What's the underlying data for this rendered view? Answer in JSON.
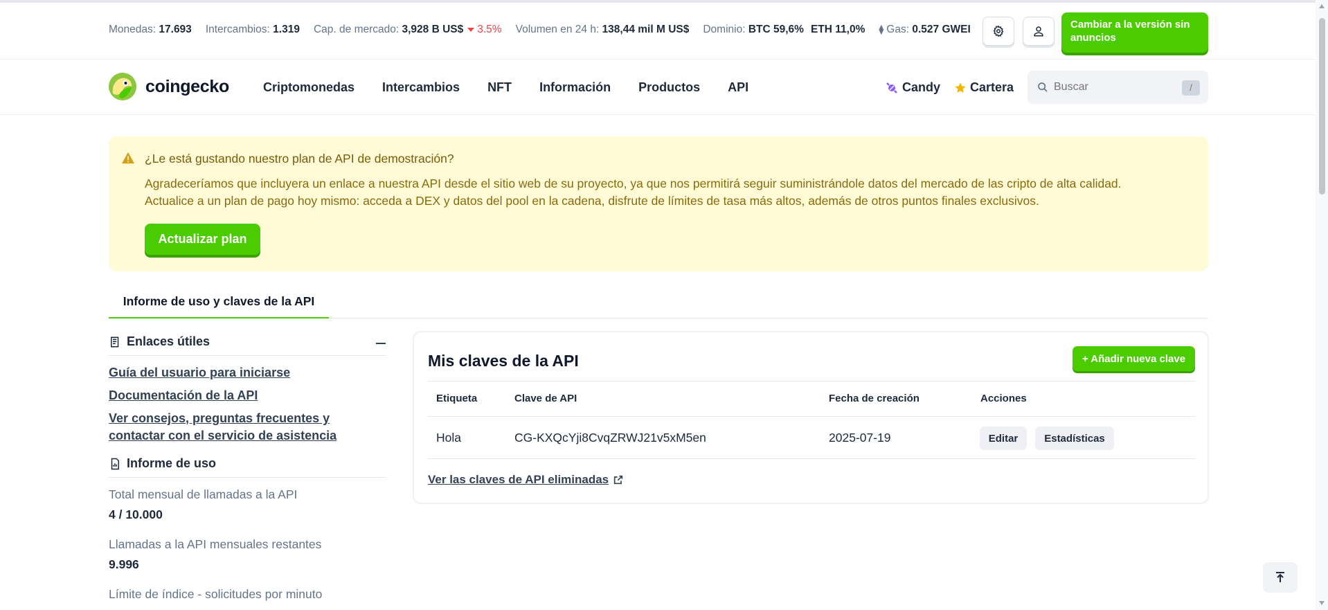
{
  "stats": {
    "coins_label": "Monedas:",
    "coins_value": "17.693",
    "exchanges_label": "Intercambios:",
    "exchanges_value": "1.319",
    "marketcap_label": "Cap. de mercado:",
    "marketcap_value": "3,928 B US$",
    "marketcap_change": "3.5%",
    "volume_label": "Volumen en 24 h:",
    "volume_value": "138,44 mil M US$",
    "dominance_label": "Dominio:",
    "btc_dominance": "BTC 59,6%",
    "eth_dominance": "ETH 11,0%",
    "gas_label": "Gas:",
    "gas_value": "0.527 GWEI"
  },
  "header": {
    "adfree_button": "Cambiar a la versión sin anuncios",
    "accent_color": "#4bcc00"
  },
  "nav": {
    "logo_text": "coingecko",
    "links": [
      "Criptomonedas",
      "Intercambios",
      "NFT",
      "Información",
      "Productos",
      "API"
    ],
    "candy": "Candy",
    "portfolio": "Cartera",
    "search_placeholder": "Buscar",
    "search_shortcut": "/"
  },
  "banner": {
    "title": "¿Le está gustando nuestro plan de API de demostración?",
    "body_line1": "Agradeceríamos que incluyera un enlace a nuestra API desde el sitio web de su proyecto, ya que nos permitirá seguir suministrándole datos del mercado de las cripto de alta calidad.",
    "body_line2": "Actualice a un plan de pago hoy mismo: acceda a DEX y datos del pool en la cadena, disfrute de límites de tasa más altos, además de otros puntos finales exclusivos.",
    "button": "Actualizar plan"
  },
  "tabs": {
    "active": "Informe de uso y claves de la API"
  },
  "sidebar": {
    "useful_links_title": "Enlaces útiles",
    "links": [
      "Guía del usuario para iniciarse",
      "Documentación de la API",
      "Ver consejos, preguntas frecuentes y contactar con el servicio de asistencia"
    ],
    "usage_title": "Informe de uso",
    "usage": [
      {
        "label": "Total mensual de llamadas a la API",
        "value": "4 / 10.000"
      },
      {
        "label": "Llamadas a la API mensuales restantes",
        "value": "9.996"
      },
      {
        "label": "Límite de índice - solicitudes por minuto",
        "value": ""
      }
    ]
  },
  "keys_card": {
    "title": "Mis claves de la API",
    "add_button": "+ Añadir nueva clave",
    "columns": [
      "Etiqueta",
      "Clave de API",
      "Fecha de creación",
      "Acciones"
    ],
    "rows": [
      {
        "label": "Hola",
        "key": "CG-KXQcYji8CvqZRWJ21v5xM5en",
        "created": "2025-07-19",
        "edit": "Editar",
        "stats": "Estadísticas"
      }
    ],
    "deleted_link": "Ver las claves de API eliminadas"
  }
}
